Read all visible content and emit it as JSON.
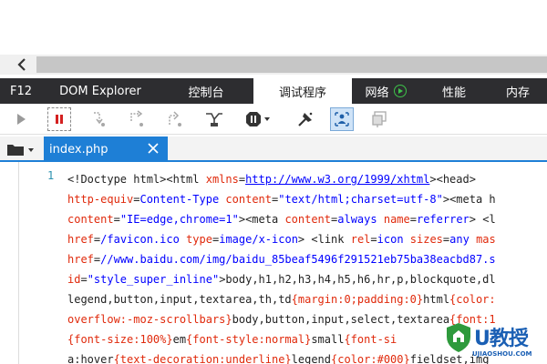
{
  "scroll": {
    "left_arrow": "scroll-left"
  },
  "tabs": [
    {
      "label": "F12",
      "active": false
    },
    {
      "label": "DOM Explorer",
      "active": false
    },
    {
      "label": "控制台",
      "active": false
    },
    {
      "label": "调试程序",
      "active": true
    },
    {
      "label": "网络",
      "active": false,
      "icon": "play-circle-icon"
    },
    {
      "label": "性能",
      "active": false
    },
    {
      "label": "内存",
      "active": false
    }
  ],
  "toolbar": {
    "buttons": [
      "continue-icon",
      "pause-icon",
      "step-into-icon",
      "step-over-icon",
      "step-out-icon",
      "break-on-new-worker-icon",
      "exceptions-icon",
      "pretty-print-icon",
      "just-my-code-icon",
      "source-maps-icon"
    ]
  },
  "file_tabs": [
    {
      "name": "index.php"
    }
  ],
  "editor": {
    "line_number": "1",
    "lines": [
      [
        [
          "p",
          "<!Doctype html><html "
        ],
        [
          "a",
          "xmlns"
        ],
        [
          "p",
          "="
        ],
        [
          "u",
          "http://www.w3.org/1999/xhtml"
        ],
        [
          "p",
          "><head>"
        ]
      ],
      [
        [
          "a",
          "http-equiv"
        ],
        [
          "p",
          "="
        ],
        [
          "v",
          "Content-Type"
        ],
        [
          "p",
          " "
        ],
        [
          "a",
          "content"
        ],
        [
          "p",
          "="
        ],
        [
          "v",
          "\"text/html;charset=utf-8\""
        ],
        [
          "p",
          "><meta h"
        ]
      ],
      [
        [
          "a",
          "content"
        ],
        [
          "p",
          "="
        ],
        [
          "v",
          "\"IE=edge,chrome=1\""
        ],
        [
          "p",
          "><meta "
        ],
        [
          "a",
          "content"
        ],
        [
          "p",
          "="
        ],
        [
          "v",
          "always"
        ],
        [
          "p",
          " "
        ],
        [
          "a",
          "name"
        ],
        [
          "p",
          "="
        ],
        [
          "v",
          "referrer"
        ],
        [
          "p",
          "> <l"
        ]
      ],
      [
        [
          "a",
          "href"
        ],
        [
          "p",
          "="
        ],
        [
          "v",
          "/favicon.ico"
        ],
        [
          "p",
          " "
        ],
        [
          "a",
          "type"
        ],
        [
          "p",
          "="
        ],
        [
          "v",
          "image/x-icon"
        ],
        [
          "p",
          "> <link "
        ],
        [
          "a",
          "rel"
        ],
        [
          "p",
          "="
        ],
        [
          "v",
          "icon"
        ],
        [
          "p",
          " "
        ],
        [
          "a",
          "sizes"
        ],
        [
          "p",
          "="
        ],
        [
          "v",
          "any"
        ],
        [
          "p",
          " "
        ],
        [
          "a",
          "mas"
        ]
      ],
      [
        [
          "a",
          "href"
        ],
        [
          "p",
          "="
        ],
        [
          "v",
          "//www.baidu.com/img/baidu_85beaf5496f291521eb75ba38eacbd87.s"
        ]
      ],
      [
        [
          "a",
          "id"
        ],
        [
          "p",
          "="
        ],
        [
          "v",
          "\"style_super_inline\""
        ],
        [
          "p",
          ">"
        ],
        [
          "t",
          "body,h1,h2,h3,h4,h5,h6,hr,p,blockquote,dl"
        ]
      ],
      [
        [
          "t",
          "legend,button,input,textarea,th,td"
        ],
        [
          "a",
          "{margin:0;padding:0}"
        ],
        [
          "t",
          "html"
        ],
        [
          "a",
          "{color:"
        ]
      ],
      [
        [
          "a",
          "overflow:-moz-scrollbars}"
        ],
        [
          "t",
          "body,button,input,select,textarea"
        ],
        [
          "a",
          "{font:1"
        ]
      ],
      [
        [
          "a",
          "{font-size:100%}"
        ],
        [
          "t",
          "em"
        ],
        [
          "a",
          "{font-style:normal}"
        ],
        [
          "t",
          "small"
        ],
        [
          "a",
          "{font-si"
        ]
      ],
      [
        [
          "t",
          "a:hover"
        ],
        [
          "a",
          "{text-decoration:underline}"
        ],
        [
          "t",
          "legend"
        ],
        [
          "a",
          "{color:#000}"
        ],
        [
          "t",
          "fieldset,img"
        ]
      ]
    ]
  },
  "watermark": {
    "logo_text": "U教授",
    "logo_url_text": "UJIAOSHOU.COM"
  }
}
